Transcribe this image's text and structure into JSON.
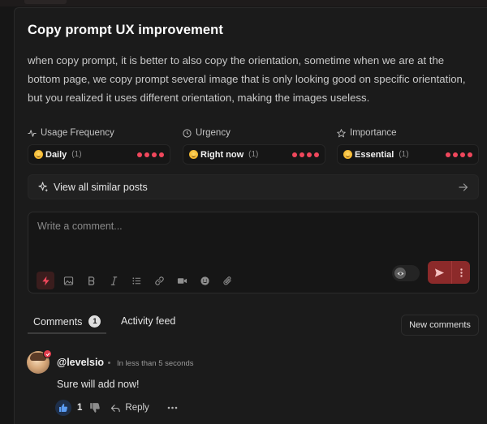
{
  "post": {
    "title": "Copy prompt UX improvement",
    "description": "when copy prompt, it is better to also copy the orientation, sometime when we are at the bottom page, we copy prompt several image that is only looking good on specific orientation, but you realized it uses different orientation, making the images useless."
  },
  "fields": [
    {
      "label": "Usage Frequency",
      "icon": "activity-icon",
      "value": "Daily",
      "count": "(1)",
      "level": 4
    },
    {
      "label": "Urgency",
      "icon": "clock-icon",
      "value": "Right now",
      "count": "(1)",
      "level": 4
    },
    {
      "label": "Importance",
      "icon": "star-icon",
      "value": "Essential",
      "count": "(1)",
      "level": 4
    }
  ],
  "similar": {
    "label": "View all similar posts"
  },
  "composer": {
    "placeholder": "Write a comment..."
  },
  "toolbar_icons": [
    "bolt-icon",
    "image-icon",
    "bold-icon",
    "italic-icon",
    "list-icon",
    "link-icon",
    "video-icon",
    "emoji-icon",
    "attachment-icon"
  ],
  "tabs": {
    "comments_label": "Comments",
    "comments_count": "1",
    "activity_label": "Activity feed"
  },
  "new_comments_label": "New comments",
  "comment": {
    "author": "@levelsio",
    "timestamp": "In less than 5 seconds",
    "text": "Sure will add now!",
    "likes": "1",
    "reply_label": "Reply"
  },
  "colors": {
    "accent": "#f0475c",
    "send": "#8c2a2a",
    "background": "#1b1b1b"
  }
}
